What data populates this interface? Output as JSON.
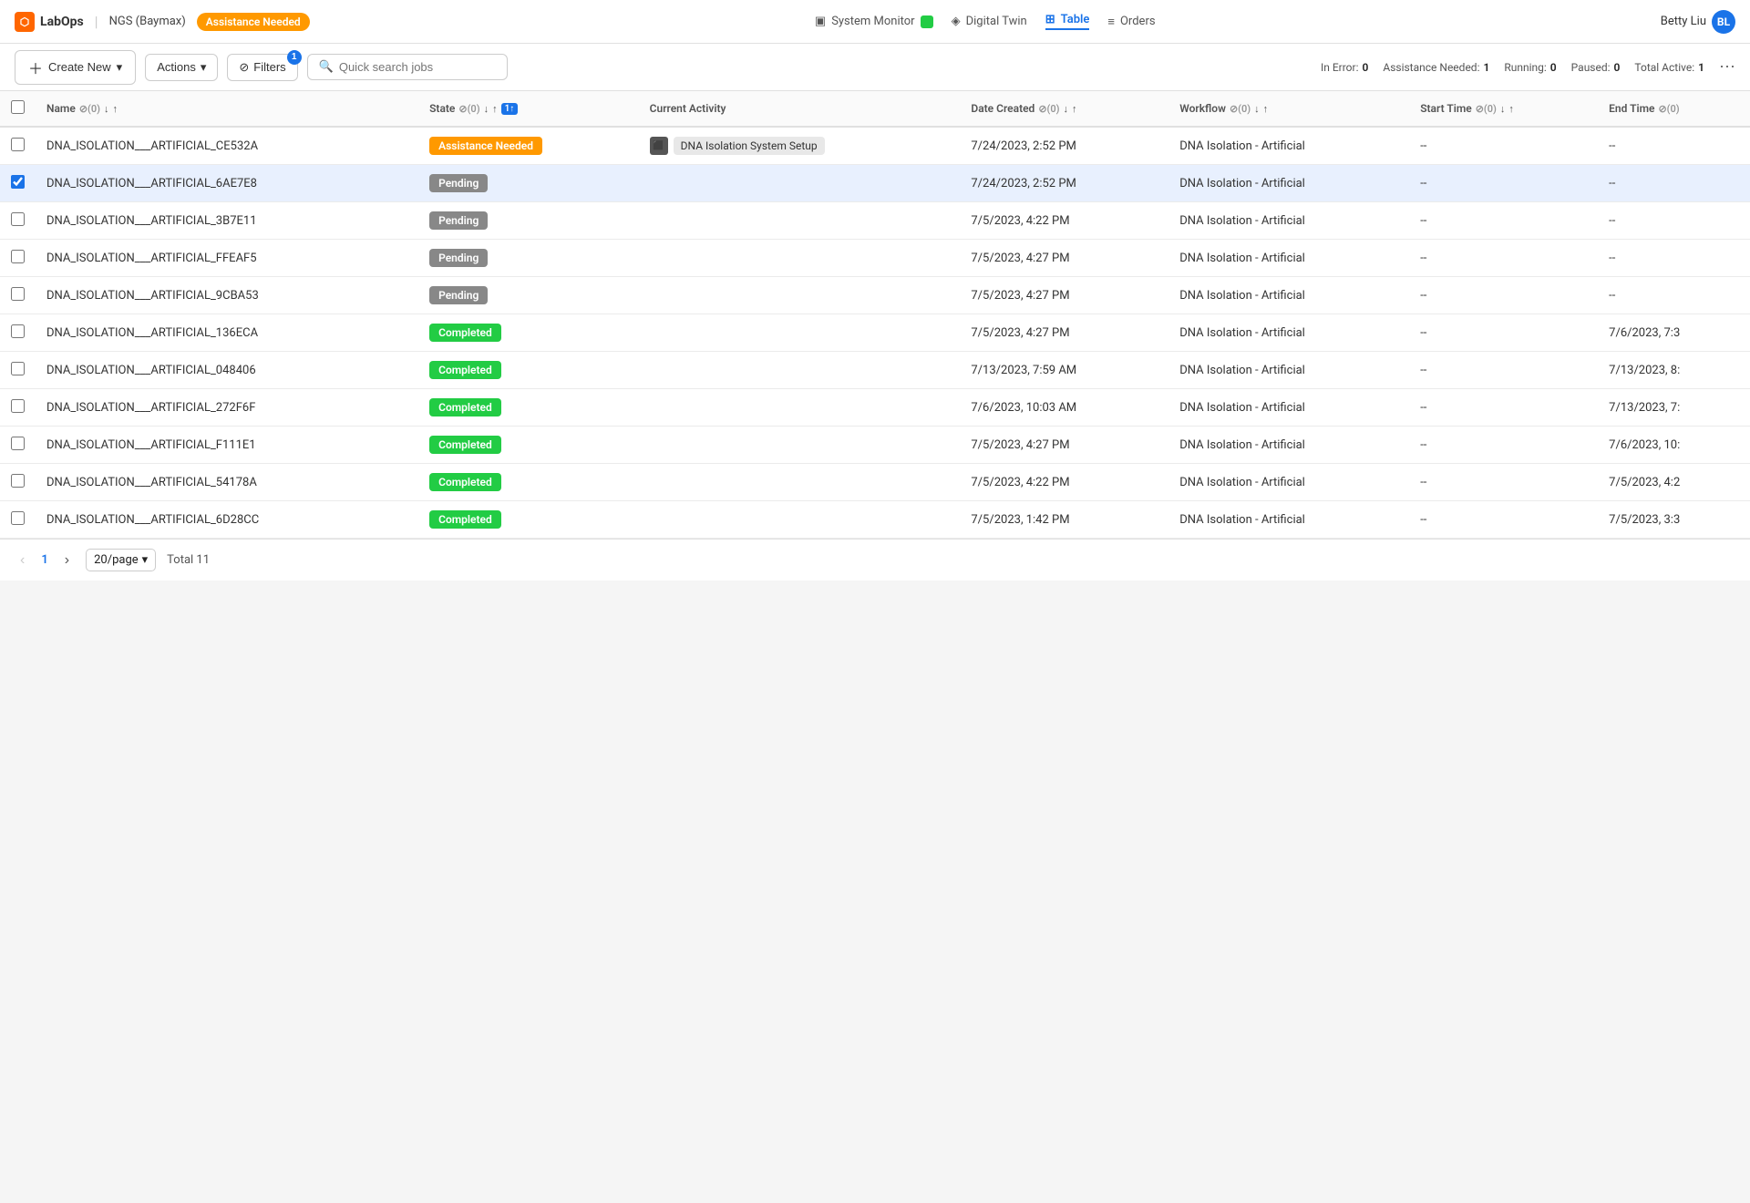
{
  "nav": {
    "logo_icon": "⬡",
    "app_name": "LabOps",
    "ngs_label": "NGS (Baymax)",
    "assistance_badge": "Assistance Needed",
    "monitor_label": "System Monitor",
    "digital_twin_label": "Digital Twin",
    "table_label": "Table",
    "orders_label": "Orders",
    "user_name": "Betty Liu",
    "user_initials": "BL"
  },
  "toolbar": {
    "create_new_label": "Create New",
    "actions_label": "Actions",
    "filters_label": "Filters",
    "filter_badge_count": "1",
    "search_placeholder": "Quick search jobs"
  },
  "status_bar": {
    "in_error_label": "In Error:",
    "in_error_count": "0",
    "assistance_needed_label": "Assistance Needed:",
    "assistance_needed_count": "1",
    "running_label": "Running:",
    "running_count": "0",
    "paused_label": "Paused:",
    "paused_count": "0",
    "total_active_label": "Total Active:",
    "total_active_count": "1"
  },
  "table": {
    "columns": [
      {
        "id": "name",
        "label": "Name",
        "filter": true,
        "sort": true
      },
      {
        "id": "state",
        "label": "State",
        "filter": true,
        "sort": true
      },
      {
        "id": "activity",
        "label": "Current Activity",
        "filter": false,
        "sort": false
      },
      {
        "id": "date_created",
        "label": "Date Created",
        "filter": true,
        "sort": true
      },
      {
        "id": "workflow",
        "label": "Workflow",
        "filter": true,
        "sort": true
      },
      {
        "id": "start_time",
        "label": "Start Time",
        "filter": true,
        "sort": true
      },
      {
        "id": "end_time",
        "label": "End Time",
        "filter": true,
        "sort": true
      }
    ],
    "rows": [
      {
        "id": "CE532A",
        "name": "DNA_ISOLATION___ARTIFICIAL_CE532A",
        "state": "Assistance Needed",
        "state_type": "assistance",
        "activity": "DNA Isolation System Setup",
        "date_created": "7/24/2023, 2:52 PM",
        "workflow": "DNA Isolation - Artificial",
        "start_time": "--",
        "end_time": "--",
        "selected": false
      },
      {
        "id": "6AE7E8",
        "name": "DNA_ISOLATION___ARTIFICIAL_6AE7E8",
        "state": "Pending",
        "state_type": "pending",
        "activity": "",
        "date_created": "7/24/2023, 2:52 PM",
        "workflow": "DNA Isolation - Artificial",
        "start_time": "--",
        "end_time": "--",
        "selected": true
      },
      {
        "id": "3B7E11",
        "name": "DNA_ISOLATION___ARTIFICIAL_3B7E11",
        "state": "Pending",
        "state_type": "pending",
        "activity": "",
        "date_created": "7/5/2023, 4:22 PM",
        "workflow": "DNA Isolation - Artificial",
        "start_time": "--",
        "end_time": "--",
        "selected": false
      },
      {
        "id": "FFEAF5",
        "name": "DNA_ISOLATION___ARTIFICIAL_FFEAF5",
        "state": "Pending",
        "state_type": "pending",
        "activity": "",
        "date_created": "7/5/2023, 4:27 PM",
        "workflow": "DNA Isolation - Artificial",
        "start_time": "--",
        "end_time": "--",
        "selected": false
      },
      {
        "id": "9CBA53",
        "name": "DNA_ISOLATION___ARTIFICIAL_9CBA53",
        "state": "Pending",
        "state_type": "pending",
        "activity": "",
        "date_created": "7/5/2023, 4:27 PM",
        "workflow": "DNA Isolation - Artificial",
        "start_time": "--",
        "end_time": "--",
        "selected": false
      },
      {
        "id": "136ECA",
        "name": "DNA_ISOLATION___ARTIFICIAL_136ECA",
        "state": "Completed",
        "state_type": "completed",
        "activity": "",
        "date_created": "7/5/2023, 4:27 PM",
        "workflow": "DNA Isolation - Artificial",
        "start_time": "--",
        "end_time": "7/6/2023, 7:3",
        "selected": false
      },
      {
        "id": "048406",
        "name": "DNA_ISOLATION___ARTIFICIAL_048406",
        "state": "Completed",
        "state_type": "completed",
        "activity": "",
        "date_created": "7/13/2023, 7:59 AM",
        "workflow": "DNA Isolation - Artificial",
        "start_time": "--",
        "end_time": "7/13/2023, 8:",
        "selected": false
      },
      {
        "id": "272F6F",
        "name": "DNA_ISOLATION___ARTIFICIAL_272F6F",
        "state": "Completed",
        "state_type": "completed",
        "activity": "",
        "date_created": "7/6/2023, 10:03 AM",
        "workflow": "DNA Isolation - Artificial",
        "start_time": "--",
        "end_time": "7/13/2023, 7:",
        "selected": false
      },
      {
        "id": "F111E1",
        "name": "DNA_ISOLATION___ARTIFICIAL_F111E1",
        "state": "Completed",
        "state_type": "completed",
        "activity": "",
        "date_created": "7/5/2023, 4:27 PM",
        "workflow": "DNA Isolation - Artificial",
        "start_time": "--",
        "end_time": "7/6/2023, 10:",
        "selected": false
      },
      {
        "id": "54178A",
        "name": "DNA_ISOLATION___ARTIFICIAL_54178A",
        "state": "Completed",
        "state_type": "completed",
        "activity": "",
        "date_created": "7/5/2023, 4:22 PM",
        "workflow": "DNA Isolation - Artificial",
        "start_time": "--",
        "end_time": "7/5/2023, 4:2",
        "selected": false
      },
      {
        "id": "6D28CC",
        "name": "DNA_ISOLATION___ARTIFICIAL_6D28CC",
        "state": "Completed",
        "state_type": "completed",
        "activity": "",
        "date_created": "7/5/2023, 1:42 PM",
        "workflow": "DNA Isolation - Artificial",
        "start_time": "--",
        "end_time": "7/5/2023, 3:3",
        "selected": false
      }
    ]
  },
  "footer": {
    "page_num": "1",
    "per_page": "20/page",
    "total_label": "Total 11"
  },
  "icons": {
    "chevron_down": "▾",
    "chevron_right": "›",
    "chevron_left": "‹",
    "plus": "+",
    "filter": "⊘",
    "search": "🔍",
    "sort_up": "▲",
    "sort_down": "▼",
    "dna_activity_icon": "⬛",
    "monitor": "▣",
    "digital_twin": "◈",
    "table": "⊞",
    "orders": "≡",
    "more": "⋯"
  }
}
